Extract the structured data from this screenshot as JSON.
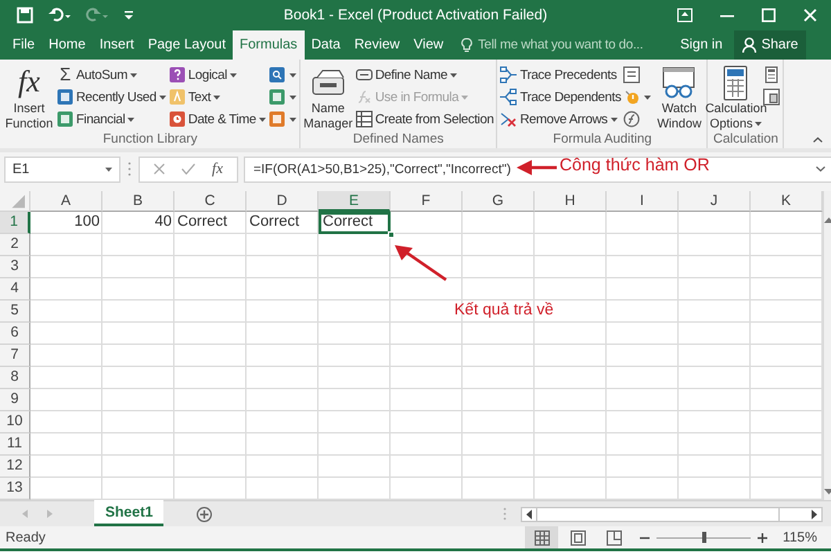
{
  "title_bar": {
    "title": "Book1 - Excel (Product Activation Failed)"
  },
  "quick_access": [
    {
      "disabled": false
    },
    {
      "disabled": false
    },
    {
      "disabled": true
    },
    {
      "disabled": false
    }
  ],
  "ribbon_tabs": [
    {
      "label": "File",
      "selected": false
    },
    {
      "label": "Home",
      "selected": false
    },
    {
      "label": "Insert",
      "selected": false
    },
    {
      "label": "Page Layout",
      "selected": false
    },
    {
      "label": "Formulas",
      "selected": true
    },
    {
      "label": "Data",
      "selected": false
    },
    {
      "label": "Review",
      "selected": false
    },
    {
      "label": "View",
      "selected": false
    }
  ],
  "tell_me": {
    "placeholder": "Tell me what you want to do..."
  },
  "account": {
    "sign_in": "Sign in",
    "share": "Share"
  },
  "ribbon_groups": [
    {
      "label": "Function Library",
      "columns": [
        [
          {
            "kind": "large",
            "glyph": "fx",
            "label": "Insert Function",
            "dropdown": false,
            "disabled": false
          }
        ],
        [
          {
            "kind": "small",
            "glyph": "Σ",
            "label": "AutoSum",
            "dropdown": true,
            "disabled": false
          },
          {
            "kind": "small",
            "label": "Recently Used",
            "dropdown": true,
            "disabled": false
          },
          {
            "kind": "small",
            "label": "Financial",
            "dropdown": true,
            "disabled": false
          }
        ],
        [
          {
            "kind": "small",
            "label": "Logical",
            "dropdown": true,
            "disabled": false
          },
          {
            "kind": "small",
            "label": "Text",
            "dropdown": true,
            "disabled": false
          },
          {
            "kind": "small",
            "label": "Date & Time",
            "dropdown": true,
            "disabled": false
          }
        ],
        [
          {
            "kind": "icon",
            "dropdown": true,
            "disabled": false
          },
          {
            "kind": "icon",
            "dropdown": true,
            "disabled": false
          },
          {
            "kind": "icon",
            "dropdown": true,
            "disabled": false
          }
        ]
      ]
    },
    {
      "label": "Defined Names",
      "columns": [
        [
          {
            "kind": "large",
            "label": "Name Manager",
            "dropdown": false,
            "disabled": false
          }
        ],
        [
          {
            "kind": "small",
            "label": "Define Name",
            "dropdown": true,
            "disabled": false
          },
          {
            "kind": "small",
            "label": "Use in Formula",
            "dropdown": true,
            "disabled": true
          },
          {
            "kind": "small",
            "label": "Create from Selection",
            "dropdown": false,
            "disabled": false
          }
        ]
      ]
    },
    {
      "label": "Formula Auditing",
      "columns": [
        [
          {
            "kind": "small",
            "label": "Trace Precedents",
            "dropdown": false,
            "disabled": false
          },
          {
            "kind": "small",
            "label": "Trace Dependents",
            "dropdown": false,
            "disabled": false
          },
          {
            "kind": "small",
            "label": "Remove Arrows",
            "dropdown": true,
            "disabled": false
          }
        ],
        [
          {
            "kind": "icon",
            "dropdown": false,
            "disabled": false
          },
          {
            "kind": "icon",
            "dropdown": true,
            "disabled": false
          },
          {
            "kind": "icon",
            "dropdown": false,
            "disabled": false
          }
        ],
        [
          {
            "kind": "large",
            "label": "Watch Window",
            "dropdown": false,
            "disabled": false
          }
        ]
      ]
    },
    {
      "label": "Calculation",
      "columns": [
        [
          {
            "kind": "large",
            "label": "Calculation Options",
            "dropdown": true,
            "disabled": false
          }
        ],
        [
          {
            "kind": "icon",
            "dropdown": false,
            "disabled": false
          },
          {
            "kind": "icon",
            "dropdown": false,
            "disabled": false
          }
        ]
      ]
    }
  ],
  "formula_bar": {
    "name_box": "E1",
    "function_glyph": "fx",
    "formula": "=IF(OR(A1>50,B1>25),\"Correct\",\"Incorrect\")"
  },
  "grid": {
    "columns": [
      {
        "label": "A",
        "selected": false
      },
      {
        "label": "B",
        "selected": false
      },
      {
        "label": "C",
        "selected": false
      },
      {
        "label": "D",
        "selected": false
      },
      {
        "label": "E",
        "selected": true
      },
      {
        "label": "F",
        "selected": false
      },
      {
        "label": "G",
        "selected": false
      },
      {
        "label": "H",
        "selected": false
      },
      {
        "label": "I",
        "selected": false
      },
      {
        "label": "J",
        "selected": false
      },
      {
        "label": "K",
        "selected": false
      }
    ],
    "rows": [
      {
        "label": "1",
        "selected": true,
        "cells": [
          {
            "text": "100",
            "right_aligned": true,
            "selected": false
          },
          {
            "text": "40",
            "right_aligned": true,
            "selected": false
          },
          {
            "text": "Correct",
            "right_aligned": false,
            "selected": false
          },
          {
            "text": "Correct",
            "right_aligned": false,
            "selected": false
          },
          {
            "text": "Correct",
            "right_aligned": false,
            "selected": true
          }
        ]
      },
      {
        "label": "2",
        "selected": false
      },
      {
        "label": "3",
        "selected": false
      },
      {
        "label": "4",
        "selected": false
      },
      {
        "label": "5",
        "selected": false
      },
      {
        "label": "6",
        "selected": false
      },
      {
        "label": "7",
        "selected": false
      },
      {
        "label": "8",
        "selected": false
      },
      {
        "label": "9",
        "selected": false
      },
      {
        "label": "10",
        "selected": false
      },
      {
        "label": "11",
        "selected": false
      },
      {
        "label": "12",
        "selected": false
      },
      {
        "label": "13",
        "selected": false
      }
    ]
  },
  "annotations": [
    {
      "text": "Công thức hàm OR",
      "kind": "arrow-left"
    },
    {
      "text": "Kết quả trả về",
      "kind": "arrow-up-left"
    }
  ],
  "sheet_tabs": [
    {
      "label": "Sheet1",
      "selected": true
    }
  ],
  "status_bar": {
    "text": "Ready",
    "view_buttons": [
      {
        "selected": true
      },
      {
        "selected": false
      },
      {
        "selected": false
      }
    ],
    "zoom_slider": {
      "level": 0.5
    },
    "zoom": "115%"
  }
}
